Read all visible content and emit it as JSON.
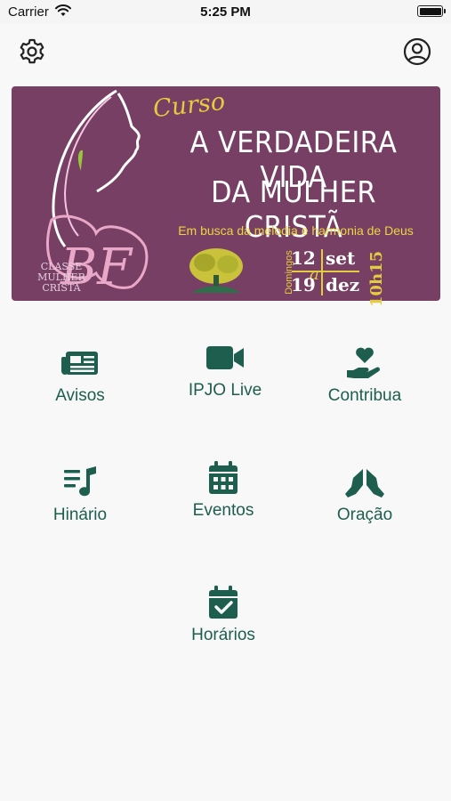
{
  "status_bar": {
    "carrier": "Carrier",
    "time": "5:25 PM"
  },
  "header": {
    "settings_icon": "gear-icon",
    "profile_icon": "user-circle-icon"
  },
  "banner": {
    "curso": "Curso",
    "title_line1": "A VERDADEIRA VIDA",
    "title_line2": "DA MULHER CRISTÃ",
    "subtitle": "Em busca da melodia e harmonia de Deus",
    "classe_line1": "CLASSE",
    "classe_line2": "MULHER",
    "classe_line3": "CRISTÃ",
    "domingos": "Domingos",
    "date_start_day": "12",
    "date_start_month": "set",
    "date_a": "a",
    "date_end_day": "19",
    "date_end_month": "dez",
    "time": "10h15",
    "colors": {
      "background": "#773f63",
      "accent": "#e2cc3f"
    }
  },
  "menu": {
    "items": [
      {
        "label": "Avisos",
        "icon": "newspaper-icon"
      },
      {
        "label": "IPJO Live",
        "icon": "video-camera-icon"
      },
      {
        "label": "Contribua",
        "icon": "hand-heart-icon"
      },
      {
        "label": "Hinário",
        "icon": "music-list-icon"
      },
      {
        "label": "Eventos",
        "icon": "calendar-icon"
      },
      {
        "label": "Oração",
        "icon": "praying-hands-icon"
      },
      {
        "label": "Horários",
        "icon": "calendar-check-icon"
      }
    ]
  },
  "theme": {
    "primary": "#1d5e4e",
    "background": "#f8f8f8"
  }
}
